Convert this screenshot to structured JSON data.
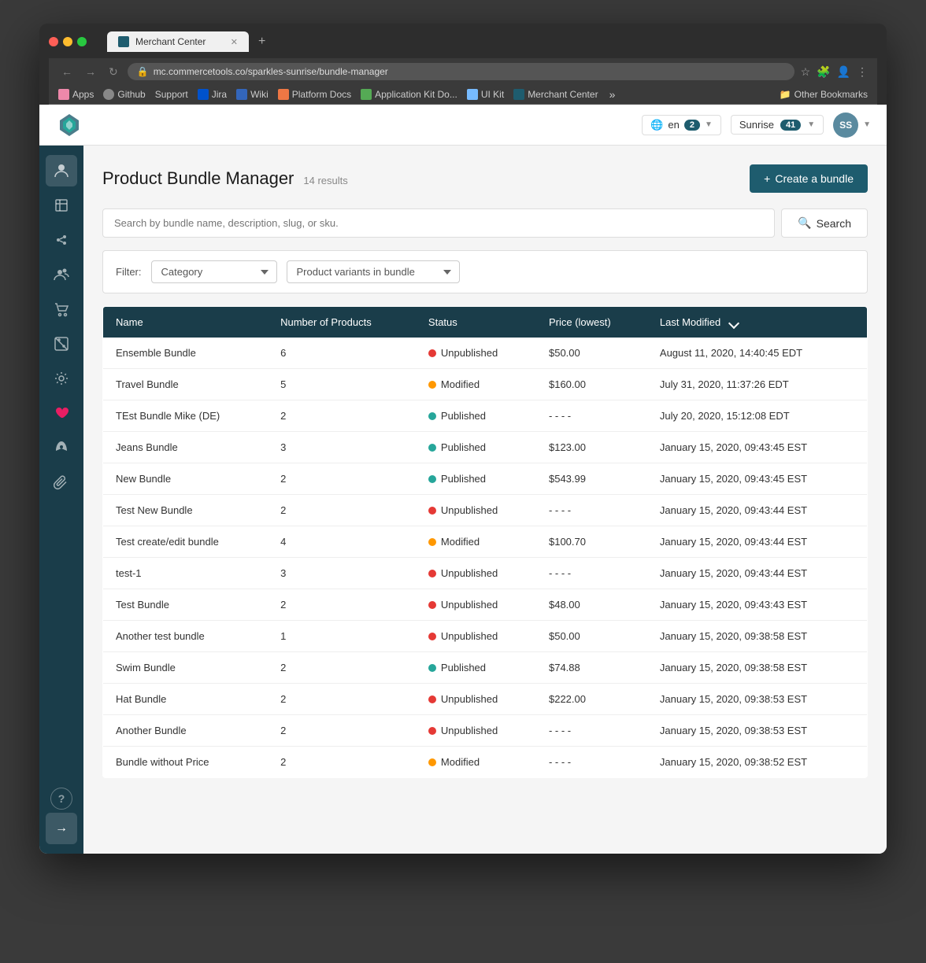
{
  "browser": {
    "url": "mc.commercetools.co/sparkles-sunrise/bundle-manager",
    "tab_title": "Merchant Center",
    "tab_icon_color": "#1e5c6e"
  },
  "bookmarks": [
    {
      "id": "apps",
      "label": "Apps",
      "color": "#e8a"
    },
    {
      "id": "github",
      "label": "Github",
      "color": "#888"
    },
    {
      "id": "support",
      "label": "Support",
      "color": "#aaa"
    },
    {
      "id": "jira",
      "label": "Jira",
      "color": "#0052cc"
    },
    {
      "id": "wiki",
      "label": "Wiki",
      "color": "#36b"
    },
    {
      "id": "platformdocs",
      "label": "Platform Docs",
      "color": "#e74"
    },
    {
      "id": "appkit",
      "label": "Application Kit Do...",
      "color": "#5a5"
    },
    {
      "id": "uikit",
      "label": "UI Kit",
      "color": "#7bf"
    },
    {
      "id": "mc",
      "label": "Merchant Center",
      "color": "#1e5c6e"
    }
  ],
  "header": {
    "lang": "en",
    "lang_badge": "2",
    "project": "Sunrise",
    "project_badge": "41",
    "avatar_initials": "SS"
  },
  "page": {
    "title": "Product Bundle Manager",
    "results_count": "14 results",
    "create_button": "Create a bundle"
  },
  "search": {
    "placeholder": "Search by bundle name, description, slug, or sku.",
    "button_label": "Search"
  },
  "filters": {
    "label": "Filter:",
    "category_placeholder": "Category",
    "variants_placeholder": "Product variants in bundle"
  },
  "table": {
    "headers": [
      "Name",
      "Number of Products",
      "Status",
      "Price (lowest)",
      "Last Modified"
    ],
    "rows": [
      {
        "name": "Ensemble Bundle",
        "num_products": "6",
        "status": "Unpublished",
        "status_type": "unpublished",
        "price": "$50.00",
        "last_modified": "August 11, 2020, 14:40:45 EDT"
      },
      {
        "name": "Travel Bundle",
        "num_products": "5",
        "status": "Modified",
        "status_type": "modified",
        "price": "$160.00",
        "last_modified": "July 31, 2020, 11:37:26 EDT"
      },
      {
        "name": "TEst Bundle Mike (DE)",
        "num_products": "2",
        "status": "Published",
        "status_type": "published",
        "price": "- - - -",
        "last_modified": "July 20, 2020, 15:12:08 EDT"
      },
      {
        "name": "Jeans Bundle",
        "num_products": "3",
        "status": "Published",
        "status_type": "published",
        "price": "$123.00",
        "last_modified": "January 15, 2020, 09:43:45 EST"
      },
      {
        "name": "New Bundle",
        "num_products": "2",
        "status": "Published",
        "status_type": "published",
        "price": "$543.99",
        "last_modified": "January 15, 2020, 09:43:45 EST"
      },
      {
        "name": "Test New Bundle",
        "num_products": "2",
        "status": "Unpublished",
        "status_type": "unpublished",
        "price": "- - - -",
        "last_modified": "January 15, 2020, 09:43:44 EST"
      },
      {
        "name": "Test create/edit bundle",
        "num_products": "4",
        "status": "Modified",
        "status_type": "modified",
        "price": "$100.70",
        "last_modified": "January 15, 2020, 09:43:44 EST"
      },
      {
        "name": "test-1",
        "num_products": "3",
        "status": "Unpublished",
        "status_type": "unpublished",
        "price": "- - - -",
        "last_modified": "January 15, 2020, 09:43:44 EST"
      },
      {
        "name": "Test Bundle",
        "num_products": "2",
        "status": "Unpublished",
        "status_type": "unpublished",
        "price": "$48.00",
        "last_modified": "January 15, 2020, 09:43:43 EST"
      },
      {
        "name": "Another test bundle",
        "num_products": "1",
        "status": "Unpublished",
        "status_type": "unpublished",
        "price": "$50.00",
        "last_modified": "January 15, 2020, 09:38:58 EST"
      },
      {
        "name": "Swim Bundle",
        "num_products": "2",
        "status": "Published",
        "status_type": "published",
        "price": "$74.88",
        "last_modified": "January 15, 2020, 09:38:58 EST"
      },
      {
        "name": "Hat Bundle",
        "num_products": "2",
        "status": "Unpublished",
        "status_type": "unpublished",
        "price": "$222.00",
        "last_modified": "January 15, 2020, 09:38:53 EST"
      },
      {
        "name": "Another Bundle",
        "num_products": "2",
        "status": "Unpublished",
        "status_type": "unpublished",
        "price": "- - - -",
        "last_modified": "January 15, 2020, 09:38:53 EST"
      },
      {
        "name": "Bundle without Price",
        "num_products": "2",
        "status": "Modified",
        "status_type": "modified",
        "price": "- - - -",
        "last_modified": "January 15, 2020, 09:38:52 EST"
      }
    ]
  },
  "sidebar": {
    "items": [
      {
        "id": "user",
        "icon": "👤",
        "label": "User"
      },
      {
        "id": "products",
        "icon": "📦",
        "label": "Products"
      },
      {
        "id": "catalog",
        "icon": "⚡",
        "label": "Catalog"
      },
      {
        "id": "customers",
        "icon": "👥",
        "label": "Customers"
      },
      {
        "id": "orders",
        "icon": "🛒",
        "label": "Orders"
      },
      {
        "id": "discounts",
        "icon": "🏷️",
        "label": "Discounts"
      },
      {
        "id": "settings",
        "icon": "⚙️",
        "label": "Settings"
      },
      {
        "id": "favorites",
        "icon": "❤️",
        "label": "Favorites"
      },
      {
        "id": "launch",
        "icon": "🚀",
        "label": "Launch"
      },
      {
        "id": "attachments",
        "icon": "📎",
        "label": "Attachments"
      }
    ],
    "bottom_items": [
      {
        "id": "help",
        "icon": "?",
        "label": "Help"
      },
      {
        "id": "expand",
        "icon": "→",
        "label": "Expand"
      }
    ]
  }
}
